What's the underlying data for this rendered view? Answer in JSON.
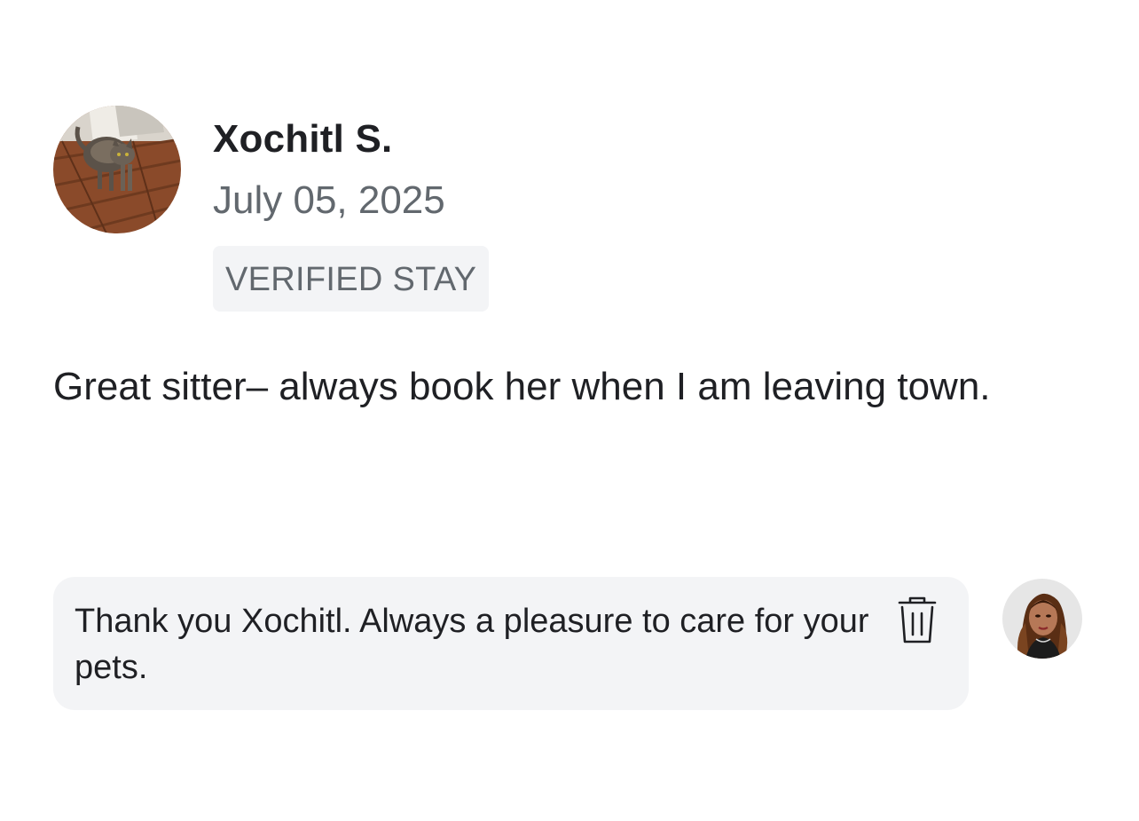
{
  "review": {
    "reviewer_name": "Xochitl S.",
    "date": "July 05, 2025",
    "badge": "VERIFIED STAY",
    "text": "Great sitter– always book her when I am leaving town.",
    "reviewer_avatar_icon": "cat-photo-avatar"
  },
  "reply": {
    "text": "Thank you Xochitl. Always a pleasure to care for your pets.",
    "delete_icon": "trash-icon",
    "sitter_avatar_icon": "sitter-photo-avatar"
  },
  "colors": {
    "text_primary": "#1f2024",
    "text_secondary": "#62686e",
    "badge_bg": "#f3f4f6",
    "reply_bg": "#f3f4f6"
  }
}
